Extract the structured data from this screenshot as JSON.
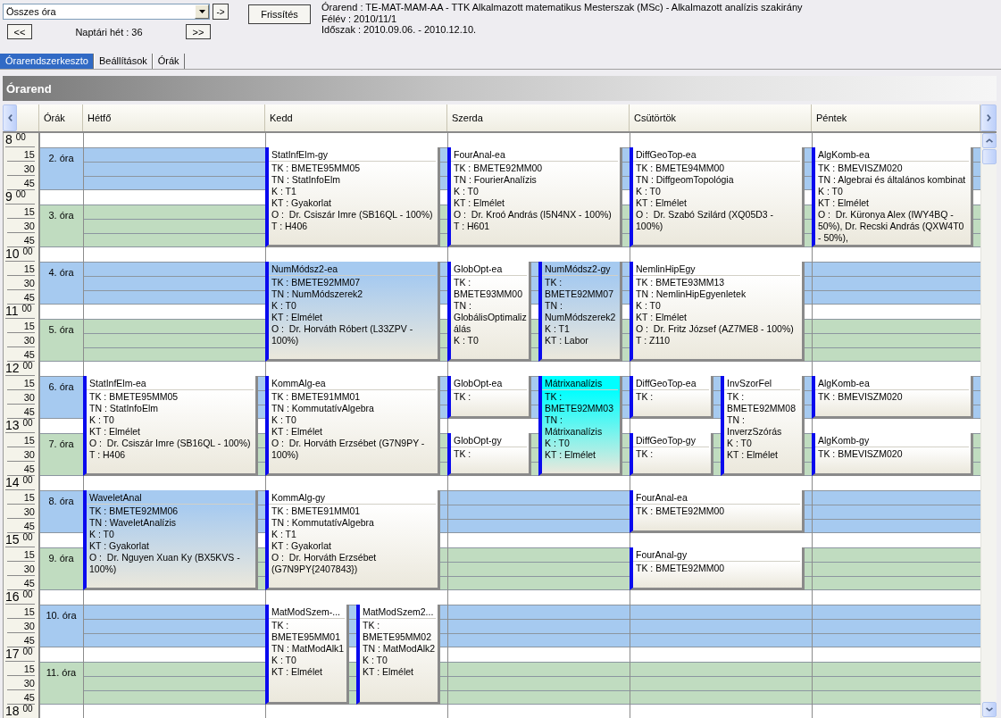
{
  "toolbar": {
    "filter": {
      "value": "Összes óra"
    },
    "go_button": "->",
    "refresh_button": "Frissítés",
    "prev_week_button": "<<",
    "week_label": "Naptári hét : 36",
    "next_week_button": ">>"
  },
  "info": [
    "Órarend : TE-MAT-MAM-AA - TTK Alkalmazott matematikus Mesterszak (MSc) - Alkalmazott analízis szakirány",
    "Félév : 2010/11/1",
    "Időszak : 2010.09.06. - 2010.12.10."
  ],
  "tabs": [
    {
      "label": "Órarendszerkeszto",
      "selected": true
    },
    {
      "label": "Beállítások",
      "selected": false
    },
    {
      "label": "Órák",
      "selected": false
    }
  ],
  "timetable": {
    "title": "Órarend",
    "period_header": "Órák",
    "days": [
      {
        "name": "Hétfő"
      },
      {
        "name": "Kedd"
      },
      {
        "name": "Szerda"
      },
      {
        "name": "Csütörtök"
      },
      {
        "name": "Péntek"
      }
    ],
    "hours": [
      {
        "hour": "8",
        "minutes": [
          "00",
          "15",
          "30",
          "45"
        ]
      },
      {
        "hour": "9",
        "minutes": [
          "00",
          "15",
          "30",
          "45"
        ]
      },
      {
        "hour": "10",
        "minutes": [
          "00",
          "15",
          "30",
          "45"
        ]
      },
      {
        "hour": "11",
        "minutes": [
          "00",
          "15",
          "30",
          "45"
        ]
      },
      {
        "hour": "12",
        "minutes": [
          "00",
          "15",
          "30",
          "45"
        ]
      },
      {
        "hour": "13",
        "minutes": [
          "00",
          "15",
          "30",
          "45"
        ]
      },
      {
        "hour": "14",
        "minutes": [
          "00",
          "15",
          "30",
          "45"
        ]
      },
      {
        "hour": "15",
        "minutes": [
          "00",
          "15",
          "30",
          "45"
        ]
      },
      {
        "hour": "16",
        "minutes": [
          "00",
          "15",
          "30",
          "45"
        ]
      },
      {
        "hour": "17",
        "minutes": [
          "00",
          "15",
          "30",
          "45"
        ]
      },
      {
        "hour": "18",
        "minutes": [
          "00"
        ]
      }
    ],
    "periods": [
      {
        "label": "2. óra",
        "color": "#a6caf0",
        "slots": [
          {
            "kind": "empty"
          },
          {
            "kind": "lessons",
            "events": [
              {
                "title": "StatInfElm-gy",
                "kind": "double",
                "color": "#ffffff",
                "details": [
                  "TK : BMETE95MM05",
                  "TN : StatInfoElm",
                  "K : T1",
                  "KT : Gyakorlat",
                  "O :  Dr. Csiszár Imre (SB16QL - 100%)",
                  "T : H406"
                ]
              }
            ]
          },
          {
            "kind": "lessons",
            "events": [
              {
                "title": "FourAnal-ea",
                "kind": "double",
                "color": "#ffffff",
                "details": [
                  "TK : BMETE92MM00",
                  "TN : FourierAnalízis",
                  "K : T0",
                  "KT : Elmélet",
                  "O :  Dr. Kroó András (I5N4NX - 100%)",
                  "T : H601"
                ]
              }
            ]
          },
          {
            "kind": "lessons",
            "events": [
              {
                "title": "DiffGeoTop-ea",
                "kind": "double",
                "color": "#ffffff",
                "details": [
                  "TK : BMETE94MM00",
                  "TN : DiffgeomTopológia",
                  "K : T0",
                  "KT : Elmélet",
                  "O :  Dr. Szabó Szilárd (XQ05D3 - 100%)"
                ]
              }
            ]
          },
          {
            "kind": "lessons",
            "events": [
              {
                "title": "AlgKomb-ea",
                "kind": "double",
                "color": "#ffffff",
                "details": [
                  "TK : BMEVISZM020",
                  "TN : Algebrai és általános kombinat",
                  "K : T0",
                  "KT : Elmélet",
                  "O :  Dr. Küronya Alex (IWY4BQ - 50%), Dr. Recski András (QXW4T0 - 50%),"
                ]
              }
            ]
          }
        ]
      },
      {
        "label": "3. óra",
        "color": "#c0dcc0",
        "slots": [
          {
            "kind": "empty"
          },
          {
            "kind": "empty"
          },
          {
            "kind": "empty"
          },
          {
            "kind": "empty"
          },
          {
            "kind": "empty"
          }
        ]
      },
      {
        "label": "4. óra",
        "color": "#a6caf0",
        "slots": [
          {
            "kind": "empty"
          },
          {
            "kind": "lessons",
            "events": [
              {
                "title": "NumMódsz2-ea",
                "kind": "double",
                "color": "#a6caf0",
                "details": [
                  "TK : BMETE92MM07",
                  "TN : NumMódszerek2",
                  "K : T0",
                  "KT : Elmélet",
                  "O :  Dr. Horváth Róbert (L33ZPV - 100%)"
                ]
              }
            ]
          },
          {
            "kind": "lessons",
            "events": [
              {
                "title": "GlobOpt-ea",
                "kind": "double",
                "color": "#ffffff",
                "details": [
                  "TK : BMETE93MM00",
                  "TN : GlobálisOptimalizálás",
                  "K : T0"
                ]
              },
              {
                "title": "NumMódsz2-gy",
                "kind": "double",
                "color": "#a6caf0",
                "details": [
                  "TK : BMETE92MM07",
                  "TN : NumMódszerek2",
                  "K : T1",
                  "KT : Labor"
                ]
              }
            ]
          },
          {
            "kind": "lessons",
            "events": [
              {
                "title": "NemlinHipEgy",
                "kind": "double",
                "color": "#ffffff",
                "details": [
                  "TK : BMETE93MM13",
                  "TN : NemlinHipEgyenletek",
                  "K : T0",
                  "KT : Elmélet",
                  "O :  Dr. Fritz József (AZ7ME8 - 100%)",
                  "T : Z110"
                ]
              }
            ]
          },
          {
            "kind": "empty"
          }
        ]
      },
      {
        "label": "5. óra",
        "color": "#c0dcc0",
        "slots": [
          {
            "kind": "empty"
          },
          {
            "kind": "empty"
          },
          {
            "kind": "empty"
          },
          {
            "kind": "empty"
          },
          {
            "kind": "empty"
          }
        ]
      },
      {
        "label": "6. óra",
        "color": "#a6caf0",
        "slots": [
          {
            "kind": "lessons",
            "events": [
              {
                "title": "StatInfElm-ea",
                "kind": "double",
                "color": "#ffffff",
                "details": [
                  "TK : BMETE95MM05",
                  "TN : StatInfoElm",
                  "K : T0",
                  "KT : Elmélet",
                  "O :  Dr. Csiszár Imre (SB16QL - 100%)",
                  "T : H406"
                ]
              }
            ]
          },
          {
            "kind": "lessons",
            "events": [
              {
                "title": "KommAlg-ea",
                "kind": "double",
                "color": "#ffffff",
                "details": [
                  "TK : BMETE91MM01",
                  "TN : KommutatívAlgebra",
                  "K : T0",
                  "KT : Elmélet",
                  "O :  Dr. Horváth Erzsébet (G7N9PY - 100%)"
                ]
              }
            ]
          },
          {
            "kind": "lessons",
            "events": [
              {
                "title": "GlobOpt-ea",
                "kind": "single",
                "color": "#ffffff",
                "details": [
                  "TK :"
                ]
              },
              {
                "title": "Mátrixanalízis",
                "kind": "double",
                "color": "#00ffff",
                "details": [
                  "TK : BMETE92MM03",
                  "TN : Mátrixanalízis",
                  "K : T0",
                  "KT : Elmélet"
                ]
              }
            ]
          },
          {
            "kind": "lessons",
            "events": [
              {
                "title": "DiffGeoTop-ea",
                "kind": "single",
                "color": "#ffffff",
                "details": [
                  "TK :"
                ]
              },
              {
                "title": "InvSzorFel",
                "kind": "double",
                "color": "#ffffff",
                "details": [
                  "TK : BMETE92MM08",
                  "TN : InverzSzórás",
                  "K : T0",
                  "KT : Elmélet"
                ]
              }
            ]
          },
          {
            "kind": "lessons",
            "events": [
              {
                "title": "AlgKomb-ea",
                "kind": "single",
                "color": "#ffffff",
                "details": [
                  "TK : BMEVISZM020"
                ]
              }
            ]
          }
        ]
      },
      {
        "label": "7. óra",
        "color": "#c0dcc0",
        "slots": [
          {
            "kind": "empty"
          },
          {
            "kind": "empty"
          },
          {
            "kind": "lessons",
            "events": [
              {
                "title": "GlobOpt-gy",
                "kind": "single",
                "color": "#ffffff",
                "details": [
                  "TK :"
                ]
              }
            ]
          },
          {
            "kind": "lessons",
            "events": [
              {
                "title": "DiffGeoTop-gy",
                "kind": "single",
                "color": "#ffffff",
                "details": [
                  "TK :"
                ]
              }
            ]
          },
          {
            "kind": "lessons",
            "events": [
              {
                "title": "AlgKomb-gy",
                "kind": "single",
                "color": "#ffffff",
                "details": [
                  "TK : BMEVISZM020"
                ]
              }
            ]
          }
        ]
      },
      {
        "label": "8. óra",
        "color": "#a6caf0",
        "slots": [
          {
            "kind": "lessons",
            "events": [
              {
                "title": "WaveletAnal",
                "kind": "double",
                "color": "#a6caf0",
                "details": [
                  "TK : BMETE92MM06",
                  "TN : WaveletAnalízis",
                  "K : T0",
                  "KT : Gyakorlat",
                  "O :  Dr. Nguyen Xuan Ky (BX5KVS - 100%)"
                ]
              }
            ]
          },
          {
            "kind": "lessons",
            "events": [
              {
                "title": "KommAlg-gy",
                "kind": "double",
                "color": "#ffffff",
                "details": [
                  "TK : BMETE91MM01",
                  "TN : KommutatívAlgebra",
                  "K : T1",
                  "KT : Gyakorlat",
                  "O :  Dr. Horváth Erzsébet (G7N9PY{2407843})"
                ]
              }
            ]
          },
          {
            "kind": "empty"
          },
          {
            "kind": "lessons",
            "events": [
              {
                "title": "FourAnal-ea",
                "kind": "single",
                "color": "#ffffff",
                "details": [
                  "TK : BMETE92MM00"
                ]
              }
            ]
          },
          {
            "kind": "empty"
          }
        ]
      },
      {
        "label": "9. óra",
        "color": "#c0dcc0",
        "slots": [
          {
            "kind": "empty"
          },
          {
            "kind": "empty"
          },
          {
            "kind": "empty"
          },
          {
            "kind": "lessons",
            "events": [
              {
                "title": "FourAnal-gy",
                "kind": "single",
                "color": "#ffffff",
                "details": [
                  "TK : BMETE92MM00"
                ]
              }
            ]
          },
          {
            "kind": "empty"
          }
        ]
      },
      {
        "label": "10. óra",
        "color": "#a6caf0",
        "slots": [
          {
            "kind": "empty"
          },
          {
            "kind": "lessons",
            "events": [
              {
                "title": "MatModSzem-...",
                "kind": "double",
                "color": "#ffffff",
                "details": [
                  "TK : BMETE95MM01",
                  "TN : MatModAlk1",
                  "K : T0",
                  "KT : Elmélet"
                ]
              },
              {
                "title": "MatModSzem2...",
                "kind": "double",
                "color": "#ffffff",
                "details": [
                  "TK : BMETE95MM02",
                  "TN : MatModAlk2",
                  "K : T0",
                  "KT : Elmélet"
                ]
              }
            ]
          },
          {
            "kind": "empty"
          },
          {
            "kind": "empty"
          },
          {
            "kind": "empty"
          }
        ]
      },
      {
        "label": "11. óra",
        "color": "#c0dcc0",
        "slots": [
          {
            "kind": "empty"
          },
          {
            "kind": "empty"
          },
          {
            "kind": "empty"
          },
          {
            "kind": "empty"
          },
          {
            "kind": "empty"
          }
        ]
      }
    ]
  }
}
